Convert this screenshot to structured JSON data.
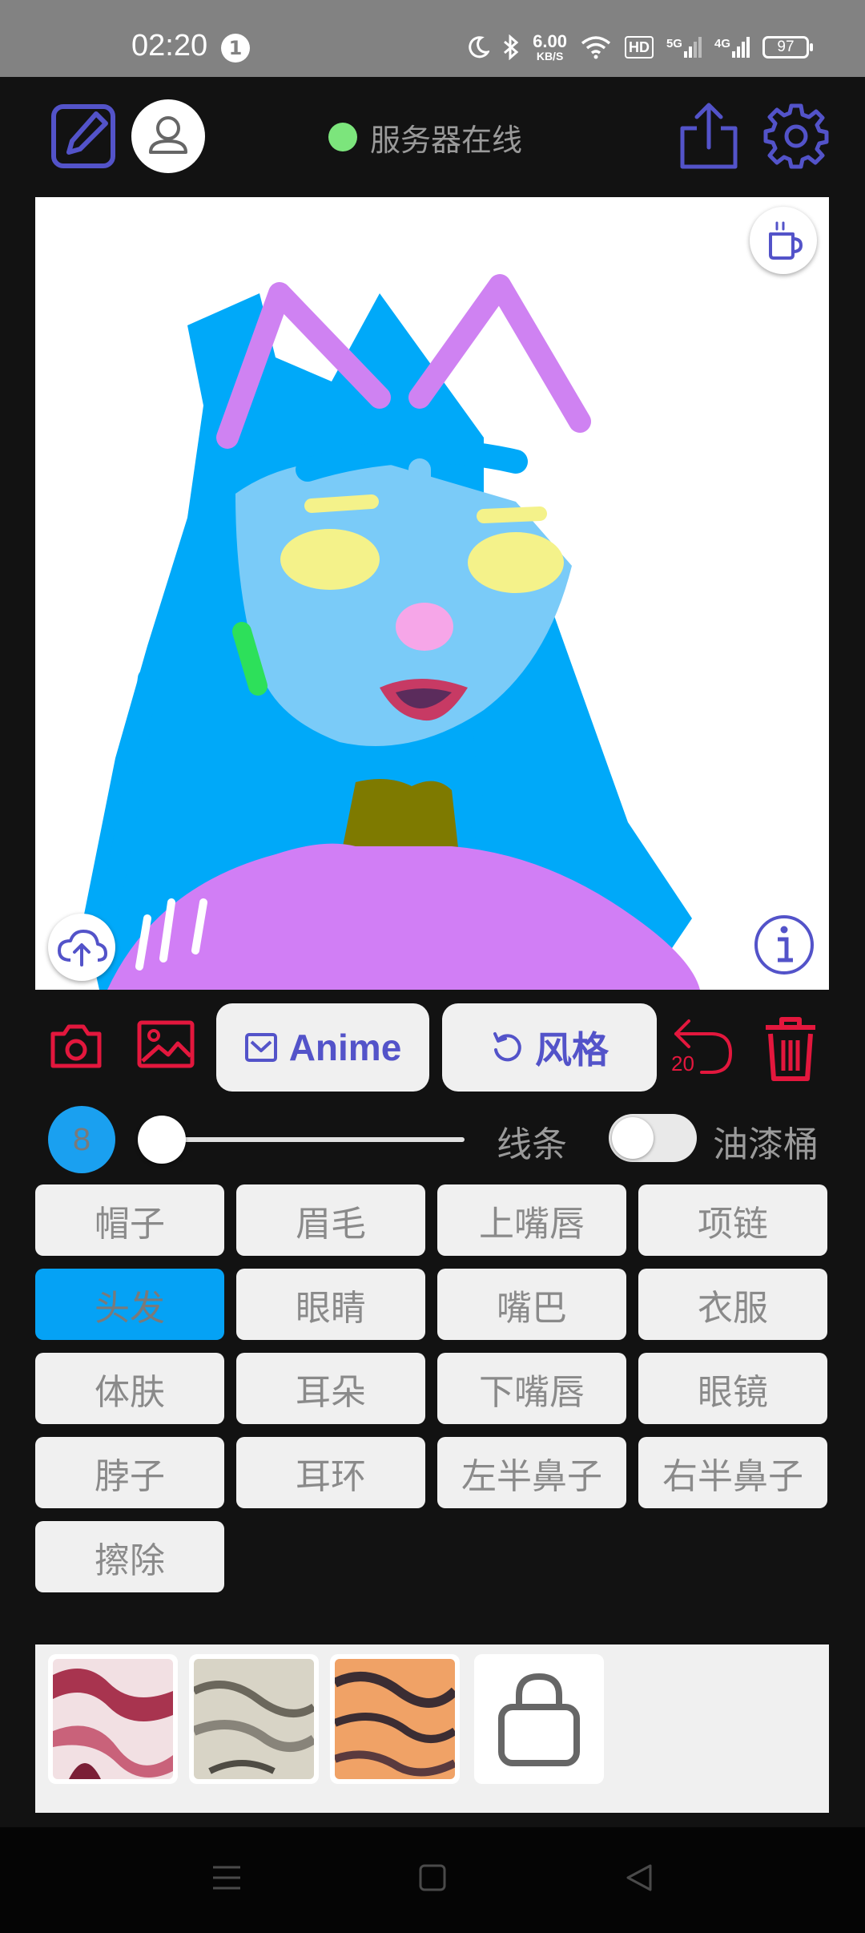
{
  "status_bar": {
    "time": "02:20",
    "notification_count": "1",
    "net_speed_value": "6.00",
    "net_speed_unit": "KB/S",
    "hd_label": "HD",
    "signal1_label": "5G",
    "signal2_label": "4G",
    "battery": "97"
  },
  "toolbar": {
    "server_status": "服务器在线",
    "server_status_color": "#7CE57C",
    "accent_color": "#5353C9"
  },
  "actions": {
    "anime_label": "Anime",
    "style_label": "风格",
    "undo_count": "20",
    "danger_color": "#E3173D"
  },
  "brush": {
    "size": "8",
    "size_fraction": 0.04,
    "line_label": "线条",
    "bucket_label": "油漆桶",
    "bucket_enabled": false
  },
  "parts": [
    {
      "label": "帽子",
      "active": false
    },
    {
      "label": "眉毛",
      "active": false
    },
    {
      "label": "上嘴唇",
      "active": false
    },
    {
      "label": "项链",
      "active": false
    },
    {
      "label": "头发",
      "active": true
    },
    {
      "label": "眼睛",
      "active": false
    },
    {
      "label": "嘴巴",
      "active": false
    },
    {
      "label": "衣服",
      "active": false
    },
    {
      "label": "体肤",
      "active": false
    },
    {
      "label": "耳朵",
      "active": false
    },
    {
      "label": "下嘴唇",
      "active": false
    },
    {
      "label": "眼镜",
      "active": false
    },
    {
      "label": "脖子",
      "active": false
    },
    {
      "label": "耳环",
      "active": false
    },
    {
      "label": "左半鼻子",
      "active": false
    },
    {
      "label": "右半鼻子",
      "active": false
    },
    {
      "label": "擦除",
      "active": false
    }
  ],
  "style_thumbnails": [
    {
      "name": "style-red-marble",
      "colors": [
        "#f2e0e3",
        "#a8344f"
      ]
    },
    {
      "name": "style-grey-stone",
      "colors": [
        "#d8d4c6",
        "#6b675c"
      ]
    },
    {
      "name": "style-orange-stripes",
      "colors": [
        "#f0a266",
        "#3b2d33"
      ]
    },
    {
      "name": "style-shop-bag",
      "colors": [
        "#ffffff",
        "#666666"
      ]
    }
  ],
  "nav_bar": {
    "icons": [
      "menu-icon",
      "home-icon",
      "back-icon"
    ]
  }
}
